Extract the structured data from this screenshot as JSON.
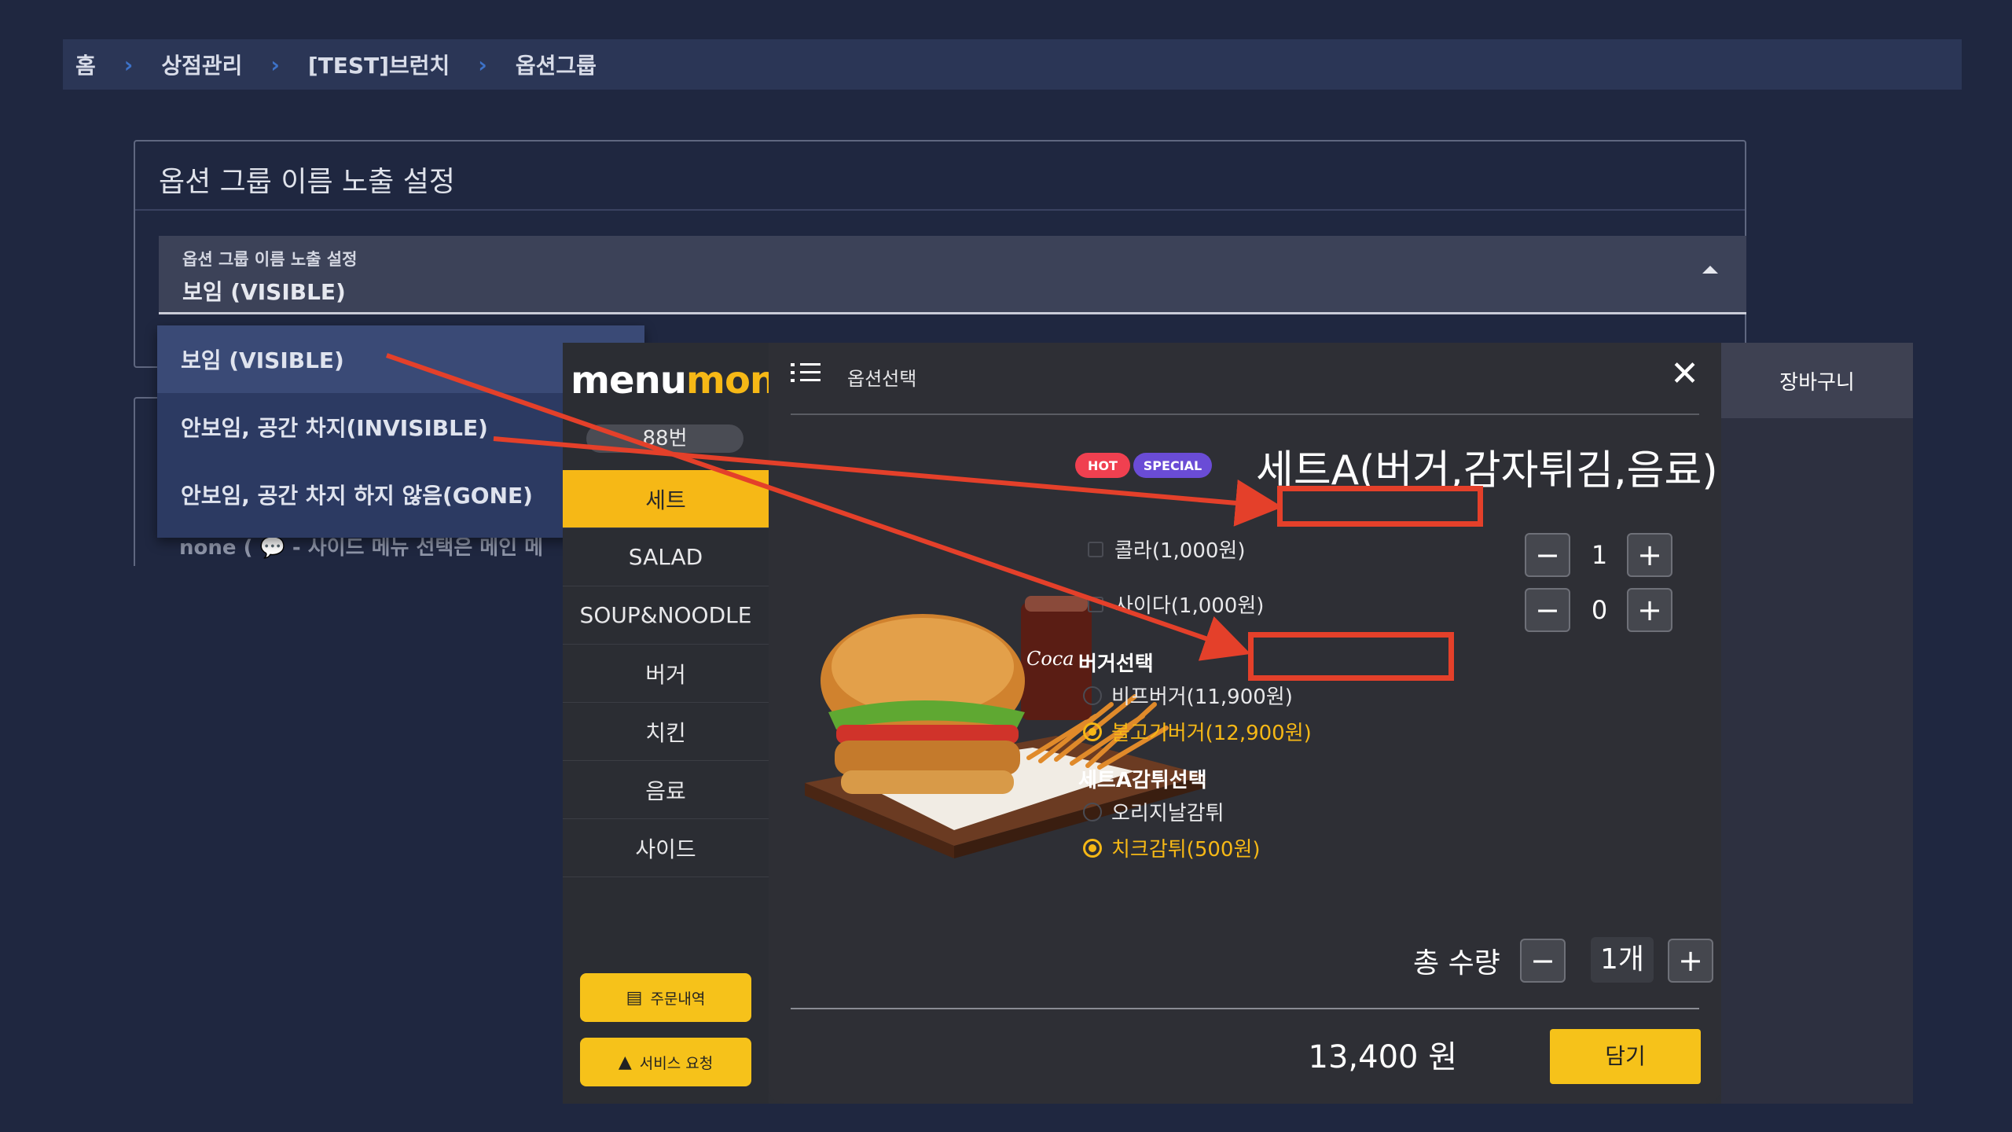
{
  "breadcrumb": [
    "홈",
    "상점관리",
    "[TEST]브런치",
    "옵션그룹"
  ],
  "settings": {
    "card_title": "옵션 그룹 이름 노출 설정",
    "select_label": "옵션 그룹 이름 노출 설정",
    "select_value": "보임 (VISIBLE)",
    "options": [
      "보임 (VISIBLE)",
      "안보임, 공간 차지(INVISIBLE)",
      "안보임, 공간 차지 하지 않음(GONE)"
    ],
    "behind_text": "none ( 💬 - 사이드 메뉴 선택은 메인 메"
  },
  "kiosk": {
    "logo_white": "menu",
    "logo_yellow": "mon",
    "table_no": "88번",
    "categories": [
      "세트",
      "SALAD",
      "SOUP&NOODLE",
      "버거",
      "치킨",
      "음료",
      "사이드"
    ],
    "active_category": "세트",
    "order_history_btn": "주문내역",
    "service_request_btn": "서비스 요청",
    "cart_label": "장바구니",
    "modal": {
      "title": "옵션선택",
      "badges": [
        "HOT",
        "SPECIAL"
      ],
      "product_name": "세트A(버거,감자튀김,음료)",
      "drinks": [
        {
          "label": "콜라(1,000원)",
          "qty": "1"
        },
        {
          "label": "사이다(1,000원)",
          "qty": "0"
        }
      ],
      "burger_group": {
        "title": "버거선택",
        "options": [
          "비프버거(11,900원)",
          "불고기버거(12,900원)"
        ],
        "selected": 1
      },
      "fries_group": {
        "title": "세트A감튀선택",
        "options": [
          "오리지날감튀",
          "치크감튀(500원)"
        ],
        "selected": 1
      },
      "total_label": "총 수량",
      "total_qty": "1개",
      "price": "13,400 원",
      "add_button": "담기",
      "minus": "−",
      "plus": "+"
    }
  },
  "colors": {
    "accent_yellow": "#f6b816",
    "annotation_red": "#e4402a",
    "page_bg": "#1f2740"
  }
}
